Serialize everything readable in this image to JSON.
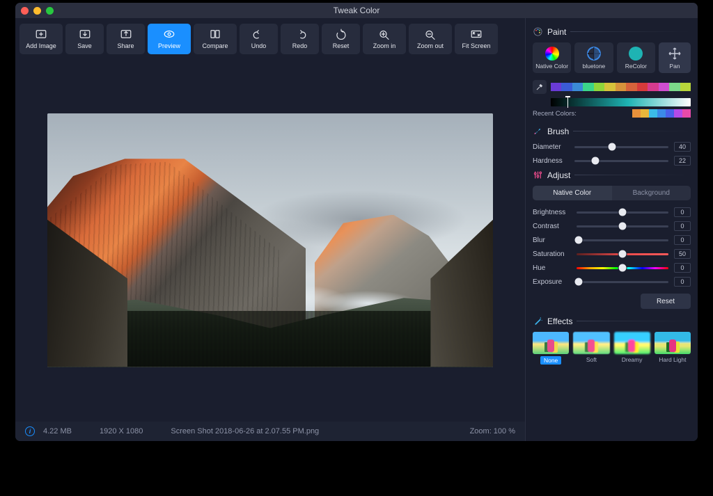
{
  "title": "Tweak Color",
  "toolbar": [
    {
      "id": "add-image",
      "label": "Add Image"
    },
    {
      "id": "save",
      "label": "Save"
    },
    {
      "id": "share",
      "label": "Share"
    },
    {
      "id": "preview",
      "label": "Preview",
      "active": true
    },
    {
      "id": "compare",
      "label": "Compare"
    },
    {
      "id": "undo",
      "label": "Undo"
    },
    {
      "id": "redo",
      "label": "Redo"
    },
    {
      "id": "reset",
      "label": "Reset"
    },
    {
      "id": "zoom-in",
      "label": "Zoom in"
    },
    {
      "id": "zoom-out",
      "label": "Zoom out"
    },
    {
      "id": "fit-screen",
      "label": "Fit Screen"
    }
  ],
  "status": {
    "size": "4.22 MB",
    "dims": "1920 X 1080",
    "filename": "Screen Shot 2018-06-26 at 2.07.55 PM.png",
    "zoom": "Zoom: 100 %"
  },
  "paint": {
    "title": "Paint",
    "modes": {
      "native": "Native Color",
      "bluetone": "bluetone",
      "recolor": "ReColor",
      "pan": "Pan",
      "recolor_hex": "#1eb3b3",
      "native_wheel": "conic"
    },
    "palette": [
      "#6a3bd6",
      "#3b5bd6",
      "#3b8ad6",
      "#3bd68a",
      "#8fd63b",
      "#d6c33b",
      "#d6933b",
      "#d6633b",
      "#d63b3b",
      "#d63b8f",
      "#cf4ed0",
      "#7cd98a",
      "#b8d63b"
    ],
    "gradient": {
      "from": "#000000",
      "mid": "#1eb3b3",
      "to": "#ffffff",
      "cursor_pct": 12
    },
    "recent_label": "Recent Colors:",
    "recent": [
      "#e8913b",
      "#e8b63b",
      "#3bbce8",
      "#3b8ae8",
      "#4a5fe8",
      "#b34ae8",
      "#e84aa9"
    ]
  },
  "brush": {
    "title": "Brush",
    "diameter_label": "Diameter",
    "diameter": 40,
    "hardness_label": "Hardness",
    "hardness": 22
  },
  "adjust": {
    "title": "Adjust",
    "tab_native": "Native Color",
    "tab_bg": "Background",
    "active_tab": "native",
    "rows": [
      {
        "id": "brightness",
        "label": "Brightness",
        "value": 0,
        "thumb": 50
      },
      {
        "id": "contrast",
        "label": "Contrast",
        "value": 0,
        "thumb": 50
      },
      {
        "id": "blur",
        "label": "Blur",
        "value": 0,
        "thumb": 2
      },
      {
        "id": "saturation",
        "label": "Saturation",
        "value": 50,
        "thumb": 50,
        "spectrum": "sat"
      },
      {
        "id": "hue",
        "label": "Hue",
        "value": 0,
        "thumb": 50,
        "spectrum": "hue"
      },
      {
        "id": "exposure",
        "label": "Exposure",
        "value": 0,
        "thumb": 2
      }
    ],
    "reset_label": "Reset"
  },
  "effects": {
    "title": "Effects",
    "items": [
      {
        "id": "none",
        "label": "None",
        "active": true
      },
      {
        "id": "soft",
        "label": "Soft"
      },
      {
        "id": "dreamy",
        "label": "Dreamy"
      },
      {
        "id": "hard-light",
        "label": "Hard Light"
      }
    ]
  }
}
